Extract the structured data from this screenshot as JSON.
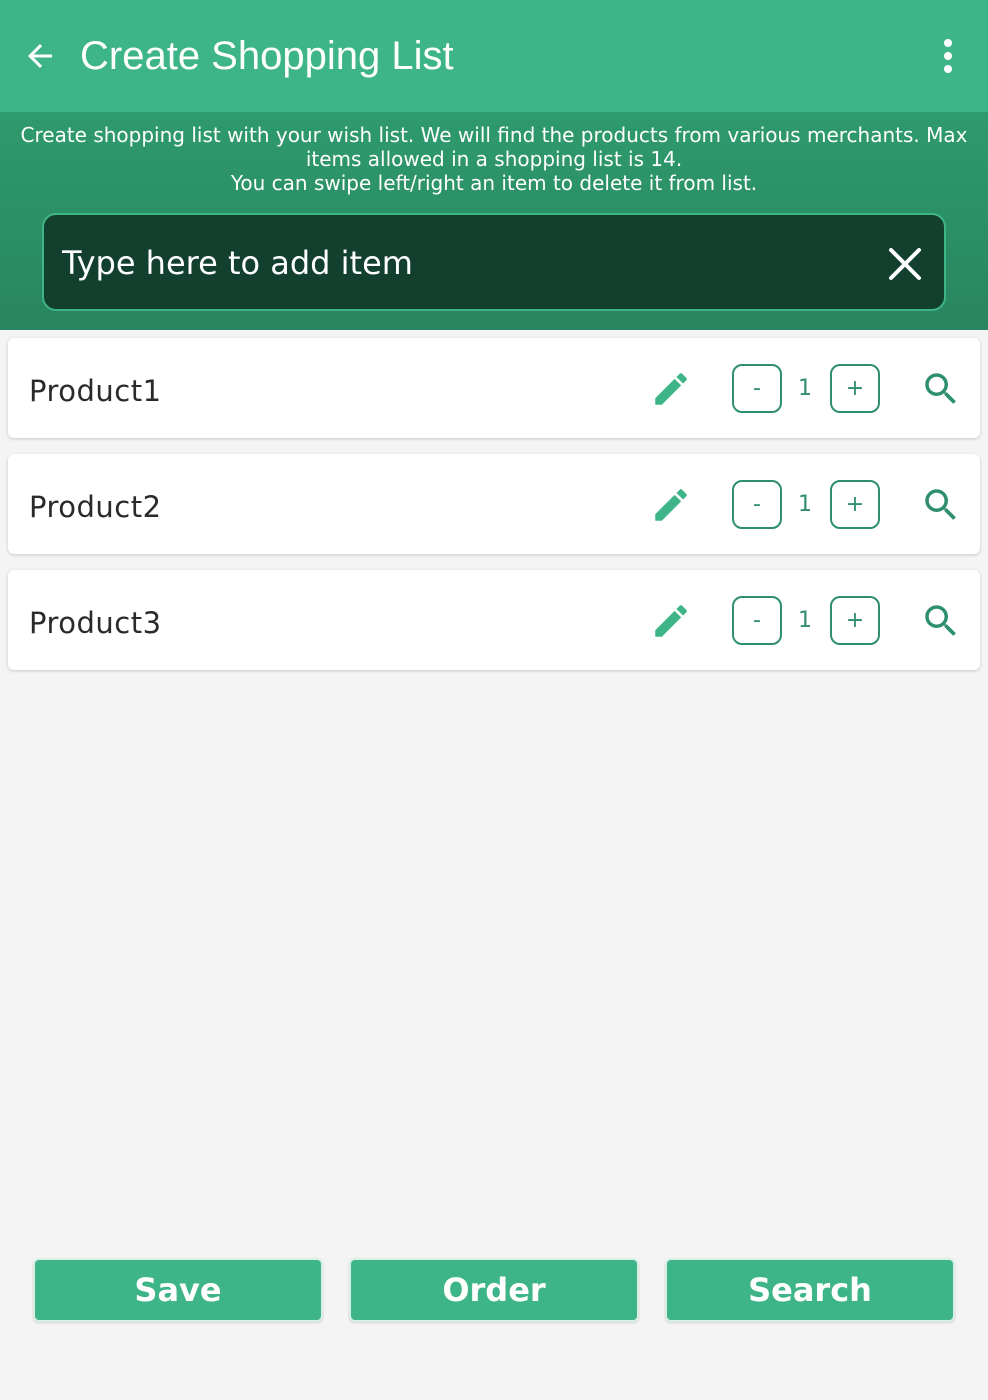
{
  "appbar": {
    "title": "Create Shopping List",
    "back_icon": "arrow-left-icon",
    "menu_icon": "more-vertical-icon"
  },
  "info": {
    "line1": "Create shopping list with your wish list. We will find the products from various merchants. Max items allowed in a shopping list is 14.",
    "line2": "You can swipe left/right an item to delete it from list."
  },
  "search": {
    "placeholder": "Type here to add item",
    "clear_icon": "close-icon"
  },
  "items": [
    {
      "name": "Product1",
      "qty": "1",
      "minus": "-",
      "plus": "+"
    },
    {
      "name": "Product2",
      "qty": "1",
      "minus": "-",
      "plus": "+"
    },
    {
      "name": "Product3",
      "qty": "1",
      "minus": "-",
      "plus": "+"
    }
  ],
  "buttons": {
    "save": "Save",
    "order": "Order",
    "search": "Search"
  },
  "colors": {
    "primary": "#3eb588",
    "panel": "#2f9a6e",
    "input_bg": "#123f2e",
    "accent_text": "#2f8f6c",
    "background": "#f4f4f4"
  }
}
